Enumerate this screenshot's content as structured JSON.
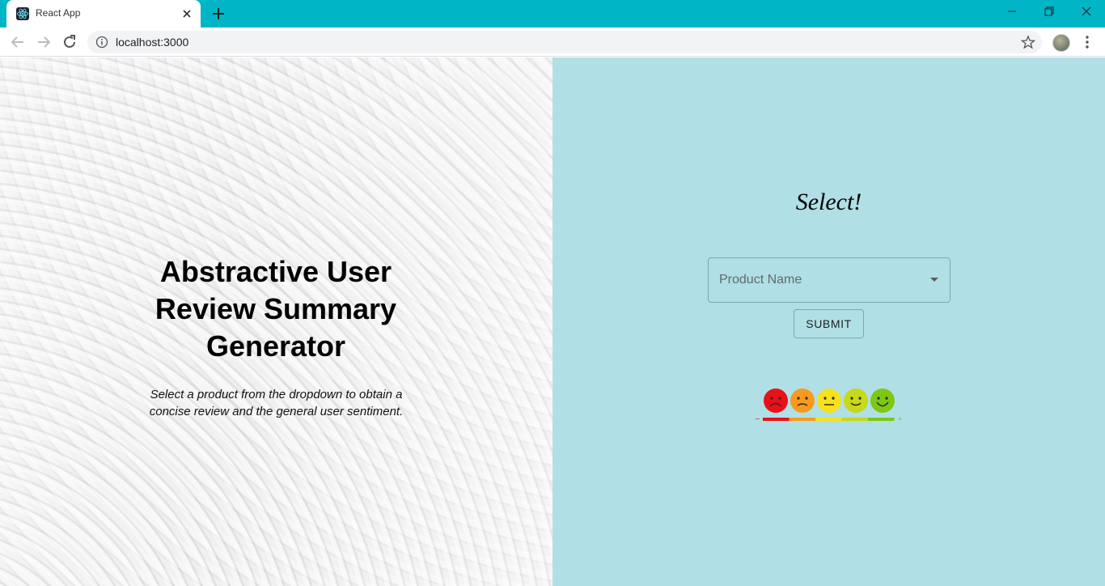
{
  "browser": {
    "tab_title": "React App",
    "url": "localhost:3000"
  },
  "hero": {
    "title": "Abstractive User Review Summary Generator",
    "subtitle": "Select a product from the dropdown to obtain a concise review and the general user sentiment."
  },
  "form": {
    "heading": "Select!",
    "dropdown_label": "Product Name",
    "submit_label": "SUBMIT"
  },
  "sentiment_scale": {
    "faces": [
      "very-sad",
      "sad",
      "neutral",
      "happy",
      "very-happy"
    ],
    "colors": [
      "#e8101a",
      "#f79a1e",
      "#f5e11d",
      "#c8d81a",
      "#7cc815"
    ]
  },
  "colors": {
    "chrome_accent": "#00b5c6",
    "right_panel_bg": "#b0dfe5"
  }
}
